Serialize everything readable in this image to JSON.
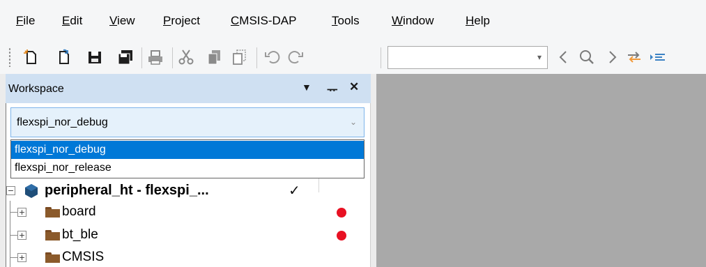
{
  "menu": {
    "items": [
      {
        "mnemonic": "F",
        "rest": "ile"
      },
      {
        "mnemonic": "E",
        "rest": "dit"
      },
      {
        "mnemonic": "V",
        "rest": "iew"
      },
      {
        "mnemonic": "P",
        "rest": "roject"
      },
      {
        "mnemonic": "C",
        "rest": "MSIS-DAP"
      },
      {
        "mnemonic": "T",
        "rest": "ools"
      },
      {
        "mnemonic": "W",
        "rest": "indow"
      },
      {
        "mnemonic": "H",
        "rest": "elp"
      }
    ]
  },
  "toolbar": {
    "find_combo_value": "",
    "icons": [
      "new-file-icon",
      "open-file-icon",
      "save-icon",
      "save-all-icon",
      "print-icon",
      "cut-icon",
      "copy-icon",
      "paste-icon",
      "undo-icon",
      "redo-icon",
      "navigate-back-icon",
      "find-icon",
      "navigate-forward-icon",
      "toggle-bookmark-icon",
      "next-statement-icon"
    ]
  },
  "workspace": {
    "title": "Workspace",
    "controls": {
      "dropdown": "▼",
      "pin": "ᅲ",
      "close": "✕"
    },
    "config_selected": "flexspi_nor_debug",
    "config_options": [
      "flexspi_nor_debug",
      "flexspi_nor_release"
    ],
    "tree": {
      "project": {
        "label": "peripheral_ht - flexspi_...",
        "check": "✓"
      },
      "items": [
        {
          "label": "board",
          "modified": true
        },
        {
          "label": "bt_ble",
          "modified": true
        },
        {
          "label": "CMSIS",
          "modified": false
        }
      ]
    }
  },
  "colors": {
    "selection": "#0078d7",
    "title_bar": "#cfe0f2",
    "folder": "#8b5a2b",
    "modified_dot": "#e81123",
    "editor_bg": "#a9a9a9"
  }
}
